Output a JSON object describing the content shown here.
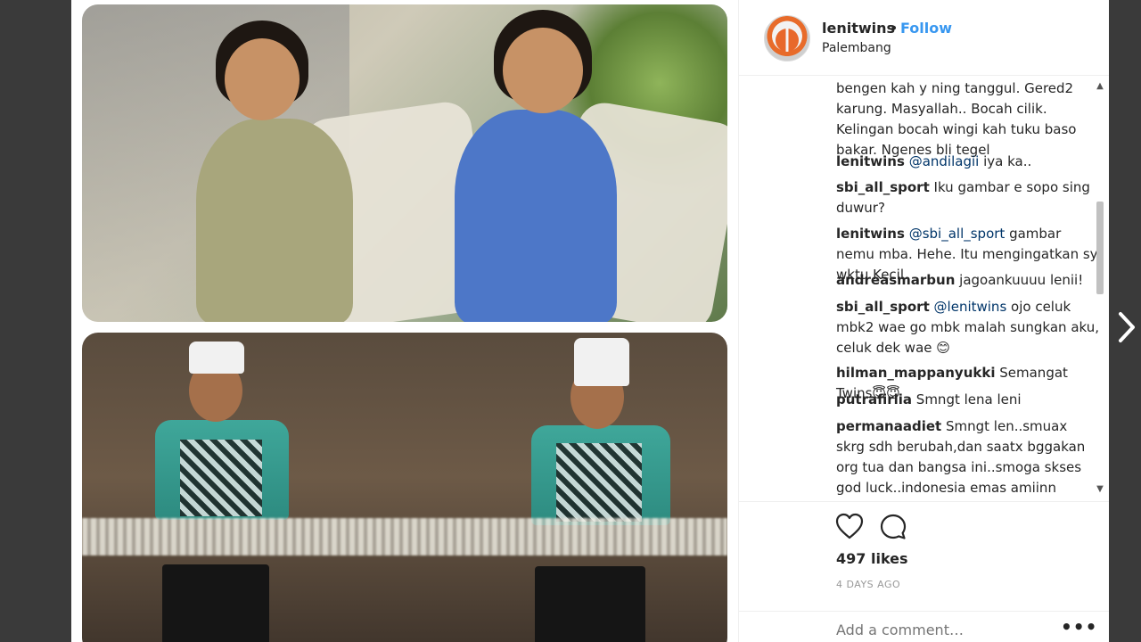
{
  "post": {
    "username": "lenitwins",
    "separator": "•",
    "follow_label": "Follow",
    "location": "Palembang"
  },
  "comments": [
    {
      "username": "",
      "text": "bengen kah y ning tanggul. Gered2 karung. Masyallah.. Bocah cilik. Kelingan bocah wingi kah tuku baso bakar. Ngenes bli tegel",
      "mention": ""
    },
    {
      "username": "lenitwins",
      "mention": "@andilagii",
      "text": " iya ka.."
    },
    {
      "username": "sbi_all_sport",
      "mention": "",
      "text": " Iku gambar e sopo sing duwur?"
    },
    {
      "username": "lenitwins",
      "mention": "@sbi_all_sport",
      "text": " gambar nemu mba. Hehe. Itu mengingatkan sy wktu Kecil."
    },
    {
      "username": "andreasmarbun",
      "mention": "",
      "text": " jagoankuuuu lenii!"
    },
    {
      "username": "sbi_all_sport",
      "mention": "@lenitwins",
      "text": " ojo celuk mbk2 wae go mbk malah sungkan aku, celuk dek wae 😊"
    },
    {
      "username": "hilman_mappanyukki",
      "mention": "",
      "text": " Semangat Twins😇😇"
    },
    {
      "username": "putrafirlia",
      "mention": "",
      "text": " Smngt lena leni"
    },
    {
      "username": "permanaadiet",
      "mention": "",
      "text": " Smngt len..smuax skrg sdh berubah,dan saatx bggakan org tua dan bangsa ini..smoga skses god luck..indonesia emas amiinn"
    }
  ],
  "stats": {
    "likes": "497 likes",
    "time": "4 DAYS AGO"
  },
  "composer": {
    "placeholder": "Add a comment…",
    "more": "•••"
  },
  "scrollbar": {
    "up": "▲",
    "down": "▼"
  },
  "icons": [
    "heart-icon",
    "comment-icon",
    "bookmark-icon",
    "next-arrow-icon",
    "more-options-icon"
  ],
  "colors": {
    "follow": "#3897f0",
    "text": "#262626",
    "muted": "#999999",
    "backdrop": "#3a3a3a"
  }
}
